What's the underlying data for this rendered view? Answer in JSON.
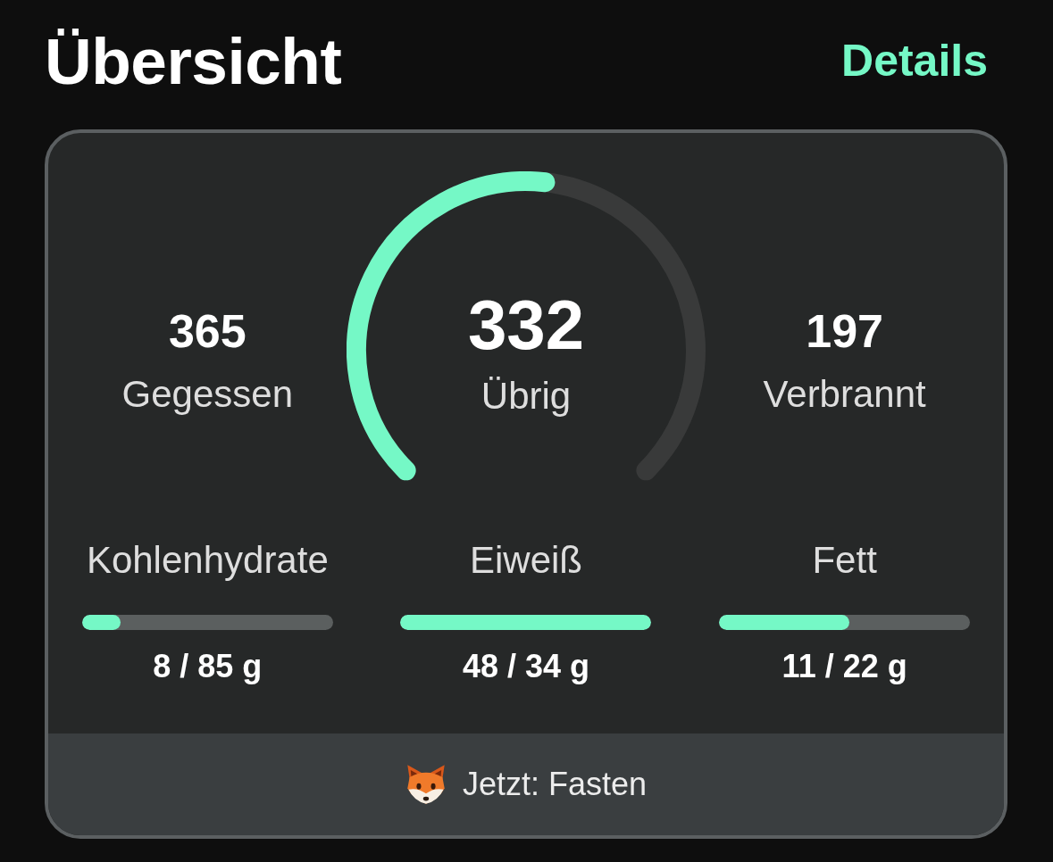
{
  "header": {
    "title": "Übersicht",
    "details_link": "Details"
  },
  "summary": {
    "stats": [
      {
        "kind": "side",
        "value": "365",
        "label": "Gegessen"
      },
      {
        "kind": "center",
        "value": "332",
        "label": "Übrig"
      },
      {
        "kind": "side",
        "value": "197",
        "label": "Verbrannt"
      }
    ],
    "gauge": {
      "level": 0.524
    }
  },
  "macros": [
    {
      "name": "Kohlenhydrate",
      "level": 0.155,
      "reading": "8 / 85 g"
    },
    {
      "name": "Eiweiß",
      "level": 1,
      "reading": "48 / 34 g"
    },
    {
      "name": "Fett",
      "level": 0.52,
      "reading": "11 / 22 g"
    }
  ],
  "footer": {
    "text": "Jetzt: Fasten"
  }
}
